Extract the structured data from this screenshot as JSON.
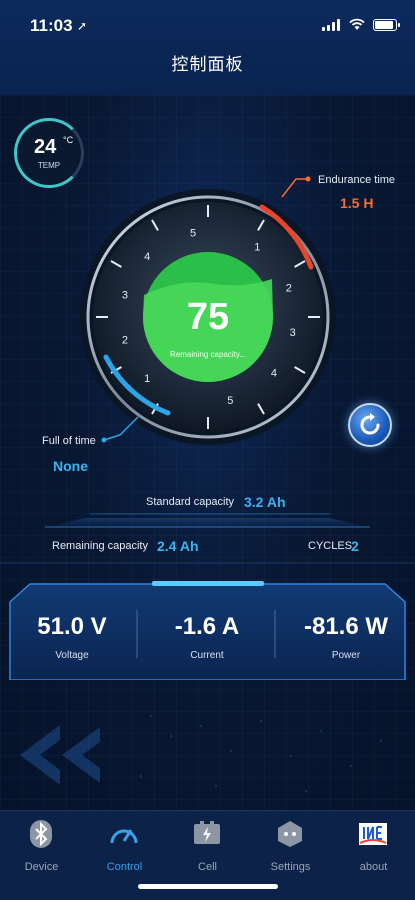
{
  "status_bar": {
    "time": "11:03"
  },
  "header": {
    "title": "控制面板"
  },
  "temperature": {
    "value": "24",
    "unit": "°C",
    "label": "TEMP"
  },
  "gauge": {
    "value": "75",
    "label": "Remaining capacity...",
    "ticks_left": [
      "5",
      "4",
      "3",
      "2",
      "1"
    ],
    "ticks_right": [
      "1",
      "2",
      "3",
      "4",
      "5"
    ],
    "colors": {
      "fill": "#3ed14f",
      "endurance_arc": "#e8452a",
      "full_arc": "#2aa6e8"
    }
  },
  "endurance": {
    "label": "Endurance time",
    "value": "1.5 H"
  },
  "full_time": {
    "label": "Full of time",
    "value": "None"
  },
  "capacity": {
    "standard_label": "Standard capacity",
    "standard_value": "3.2 Ah",
    "remaining_label": "Remaining capacity",
    "remaining_value": "2.4 Ah",
    "cycles_label": "CYCLES",
    "cycles_value": "2"
  },
  "metrics": [
    {
      "value": "51.0 V",
      "label": "Voltage"
    },
    {
      "value": "-1.6 A",
      "label": "Current"
    },
    {
      "value": "-81.6 W",
      "label": "Power"
    }
  ],
  "nav": [
    {
      "label": "Device",
      "icon": "bluetooth-icon"
    },
    {
      "label": "Control",
      "icon": "gauge-icon"
    },
    {
      "label": "Cell",
      "icon": "battery-cell-icon"
    },
    {
      "label": "Settings",
      "icon": "gear-nut-icon"
    },
    {
      "label": "about",
      "icon": "brand-logo-icon"
    }
  ],
  "colors": {
    "accent": "#3aa0e8",
    "orange": "#ff6a2a",
    "green": "#3ed14f"
  }
}
